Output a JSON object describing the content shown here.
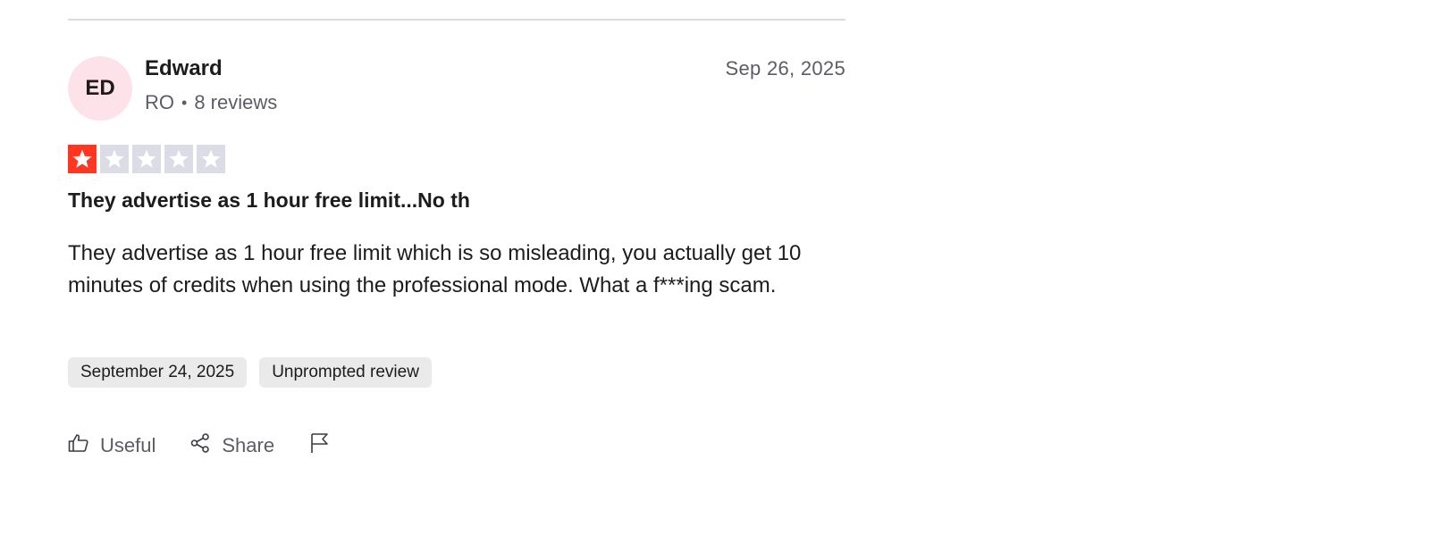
{
  "review": {
    "author": {
      "initials": "ED",
      "name": "Edward",
      "country": "RO",
      "review_count_text": "8 reviews",
      "avatar_bg": "#fde2ea"
    },
    "date_posted": "Sep 26, 2025",
    "rating": {
      "value": 1,
      "max": 5,
      "filled_color": "#ff3722",
      "empty_color": "#dcdce6"
    },
    "title": "They advertise as 1 hour free limit...No th",
    "body": "They advertise as 1 hour free limit which is so misleading, you actually get 10 minutes of credits when using the professional mode. What a f***ing scam.",
    "tags": [
      "September 24, 2025",
      "Unprompted review"
    ],
    "actions": {
      "useful_label": "Useful",
      "useful_icon": "thumbs-up-icon",
      "share_label": "Share",
      "share_icon": "share-icon",
      "report_icon": "flag-icon"
    }
  }
}
